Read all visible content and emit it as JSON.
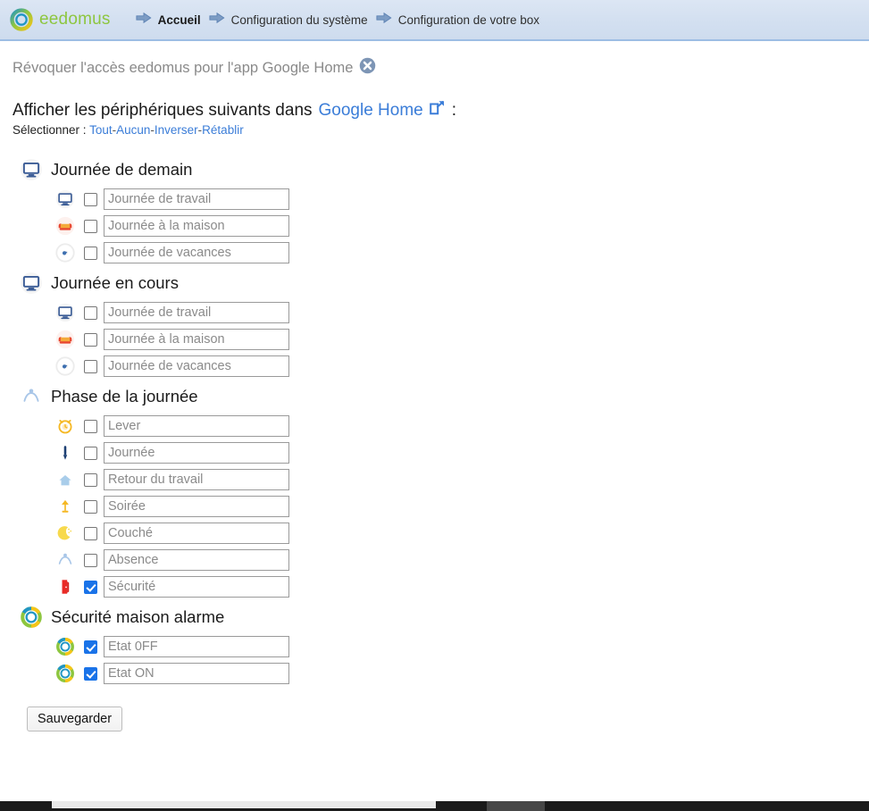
{
  "navbar": {
    "logo": {
      "icon": "eedomus-ring-logo",
      "text_part1": "ee",
      "text_part2": "domus"
    },
    "crumbs": [
      {
        "icon": "arrow-right-icon",
        "label": "Accueil",
        "active": true
      },
      {
        "icon": "arrow-right-icon",
        "label": "Configuration du système",
        "active": false
      },
      {
        "icon": "arrow-right-icon",
        "label": "Configuration de votre box",
        "active": false
      }
    ]
  },
  "revoke": {
    "text": "Révoquer l'accès eedomus pour l'app Google Home",
    "icon": "close-circle-icon"
  },
  "headline": {
    "prefix": "Afficher les périphériques suivants dans",
    "link": "Google Home",
    "link_icon": "external-link-icon",
    "suffix": ":"
  },
  "select_line": {
    "label": "Sélectionner :",
    "links": [
      "Tout",
      "Aucun",
      "Inverser",
      "Rétablir"
    ],
    "separator": "-"
  },
  "colors": {
    "navbar_bg": "#d2dff0",
    "navbar_border": "#9dbde4",
    "link": "#3b7dd8",
    "checkbox_checked": "#1a73e8",
    "muted_text": "#8a8a8a",
    "logo_green": "#8dc63f",
    "logo_blue": "#2196c4",
    "logo_yellow": "#f5c518"
  },
  "groups": [
    {
      "title": "Journée de demain",
      "icon": "monitor-icon",
      "items": [
        {
          "icon": "monitor-icon",
          "value": "Journée de travail",
          "checked": false
        },
        {
          "icon": "sofa-icon",
          "value": "Journée à la maison",
          "checked": false
        },
        {
          "icon": "faded-dot-icon",
          "value": "Journée de vacances",
          "checked": false
        }
      ]
    },
    {
      "title": "Journée en cours",
      "icon": "monitor-icon",
      "items": [
        {
          "icon": "monitor-icon",
          "value": "Journée de travail",
          "checked": false
        },
        {
          "icon": "sofa-icon",
          "value": "Journée à la maison",
          "checked": false
        },
        {
          "icon": "faded-dot-icon",
          "value": "Journée de vacances",
          "checked": false
        }
      ]
    },
    {
      "title": "Phase de la journée",
      "icon": "person-arch-icon",
      "items": [
        {
          "icon": "alarm-clock-icon",
          "value": "Lever",
          "checked": false
        },
        {
          "icon": "thermometer-icon",
          "value": "Journée",
          "checked": false
        },
        {
          "icon": "house-icon",
          "value": "Retour du travail",
          "checked": false
        },
        {
          "icon": "lamp-icon",
          "value": "Soirée",
          "checked": false
        },
        {
          "icon": "moon-icon",
          "value": "Couché",
          "checked": false
        },
        {
          "icon": "person-arch-icon",
          "value": "Absence",
          "checked": false
        },
        {
          "icon": "red-door-icon",
          "value": "Sécurité",
          "checked": true
        }
      ]
    },
    {
      "title": "Sécurité maison alarme",
      "icon": "eedomus-ring-icon",
      "items": [
        {
          "icon": "eedomus-ring-icon",
          "value": "Etat 0FF",
          "checked": true
        },
        {
          "icon": "eedomus-ring-icon",
          "value": "Etat ON",
          "checked": true
        }
      ]
    }
  ],
  "save": {
    "label": "Sauvegarder"
  }
}
